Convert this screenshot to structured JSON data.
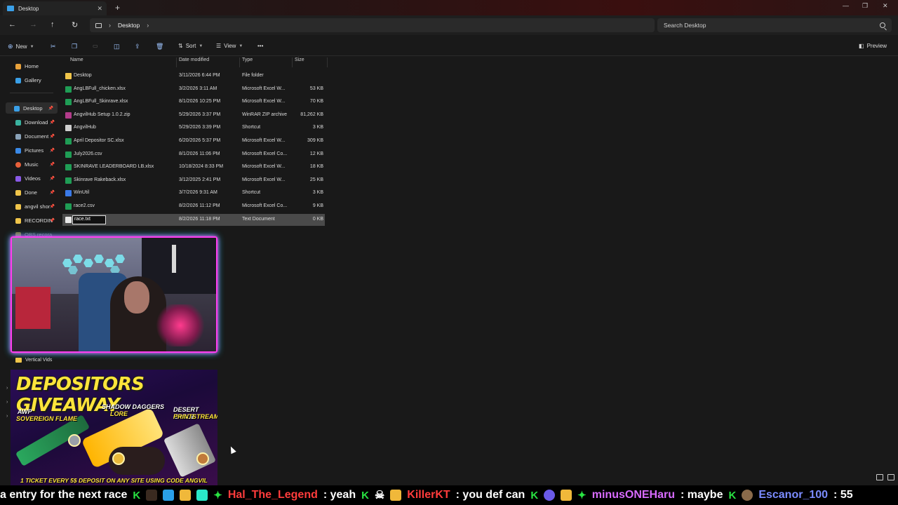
{
  "window": {
    "tab_title": "Desktop",
    "close_tab": "✕",
    "new_tab": "+",
    "minimize": "—",
    "maximize": "❐",
    "close": "✕"
  },
  "address": {
    "back": "←",
    "forward": "→",
    "up": "↑",
    "refresh": "↻",
    "breadcrumb": "Desktop",
    "search_placeholder": "Search Desktop"
  },
  "commands": {
    "new": "New",
    "sort": "Sort",
    "view": "View",
    "more": "•••",
    "preview": "Preview"
  },
  "sidebar": {
    "items": [
      {
        "label": "Home",
        "color": "#e9a23b"
      },
      {
        "label": "Gallery",
        "color": "#3aa0e8"
      },
      {
        "label": "Desktop",
        "color": "#3aa0e8"
      },
      {
        "label": "Download",
        "color": "#3ab3a0"
      },
      {
        "label": "Document",
        "color": "#8aa2b8"
      },
      {
        "label": "Pictures",
        "color": "#3a8ae8"
      },
      {
        "label": "Music",
        "color": "#e8603a"
      },
      {
        "label": "Videos",
        "color": "#8a5ae8"
      },
      {
        "label": "Done",
        "color": "#f0c54a"
      },
      {
        "label": "angvil shor",
        "color": "#f0c54a"
      },
      {
        "label": "RECORDIN",
        "color": "#f0c54a"
      },
      {
        "label": "OBS recora",
        "color": "#f0c54a"
      }
    ]
  },
  "columns": {
    "name": "Name",
    "date": "Date modified",
    "type": "Type",
    "size": "Size"
  },
  "files": [
    {
      "name": "Desktop",
      "date": "3/11/2026 6:44 PM",
      "type": "File folder",
      "size": "",
      "color": "#f0c54a"
    },
    {
      "name": "AngLBFull_chicken.xlsx",
      "date": "3/2/2026 3:11 AM",
      "type": "Microsoft Excel W...",
      "size": "53 KB",
      "color": "#1f9d55"
    },
    {
      "name": "AngLBFull_Skinrave.xlsx",
      "date": "8/1/2026 10:25 PM",
      "type": "Microsoft Excel W...",
      "size": "70 KB",
      "color": "#1f9d55"
    },
    {
      "name": "AngvilHub Setup 1.0.2.zip",
      "date": "5/29/2026 3:37 PM",
      "type": "WinRAR ZIP archive",
      "size": "81,262 KB",
      "color": "#b23b8a"
    },
    {
      "name": "AngvilHub",
      "date": "5/29/2026 3:39 PM",
      "type": "Shortcut",
      "size": "3 KB",
      "color": "#cfcfcf"
    },
    {
      "name": "April Depositor SC.xlsx",
      "date": "6/20/2026 5:37 PM",
      "type": "Microsoft Excel W...",
      "size": "309 KB",
      "color": "#1f9d55"
    },
    {
      "name": "July2026.csv",
      "date": "8/1/2026 11:06 PM",
      "type": "Microsoft Excel Co...",
      "size": "12 KB",
      "color": "#1f9d55"
    },
    {
      "name": "SKINRAVE LEADERBOARD LB.xlsx",
      "date": "10/18/2024 8:33 PM",
      "type": "Microsoft Excel W...",
      "size": "18 KB",
      "color": "#1f9d55"
    },
    {
      "name": "Skinrave Rakeback.xlsx",
      "date": "3/12/2025 2:41 PM",
      "type": "Microsoft Excel W...",
      "size": "25 KB",
      "color": "#1f9d55"
    },
    {
      "name": "WinUtil",
      "date": "3/7/2026 9:31 AM",
      "type": "Shortcut",
      "size": "3 KB",
      "color": "#3a7ae8"
    },
    {
      "name": "race2.csv",
      "date": "8/2/2026 11:12 PM",
      "type": "Microsoft Excel Co...",
      "size": "9 KB",
      "color": "#1f9d55"
    },
    {
      "name": "race.txt",
      "date": "8/2/2026 11:18 PM",
      "type": "Text Document",
      "size": "0 KB",
      "color": "#e8e8e8"
    }
  ],
  "overlay": {
    "folder_label": "Vertical Vids",
    "banner_title": "DEPOSITORS GIVEAWAY",
    "awp": "AWP",
    "awp_skin": "SOVEREIGN FLAME",
    "daggers": "SHADOW DAGGERS",
    "daggers_skin": "LORE",
    "deagle": "DESERT EAGLE",
    "deagle_skin": "PRINTSTREAM",
    "footer": "1 TICKET EVERY 5$ DEPOSIT ON ANY SITE USING CODE ANGVIL"
  },
  "chat": {
    "msg0": "a entry for the next race",
    "user1": "Hal_The_Legend",
    "msg1": ": yeah",
    "user2": "KillerKT",
    "msg2": ": you def can",
    "user3": "minusONEHaru",
    "msg3": ": maybe",
    "user4": "Escanor_100",
    "msg4": ": 55"
  }
}
